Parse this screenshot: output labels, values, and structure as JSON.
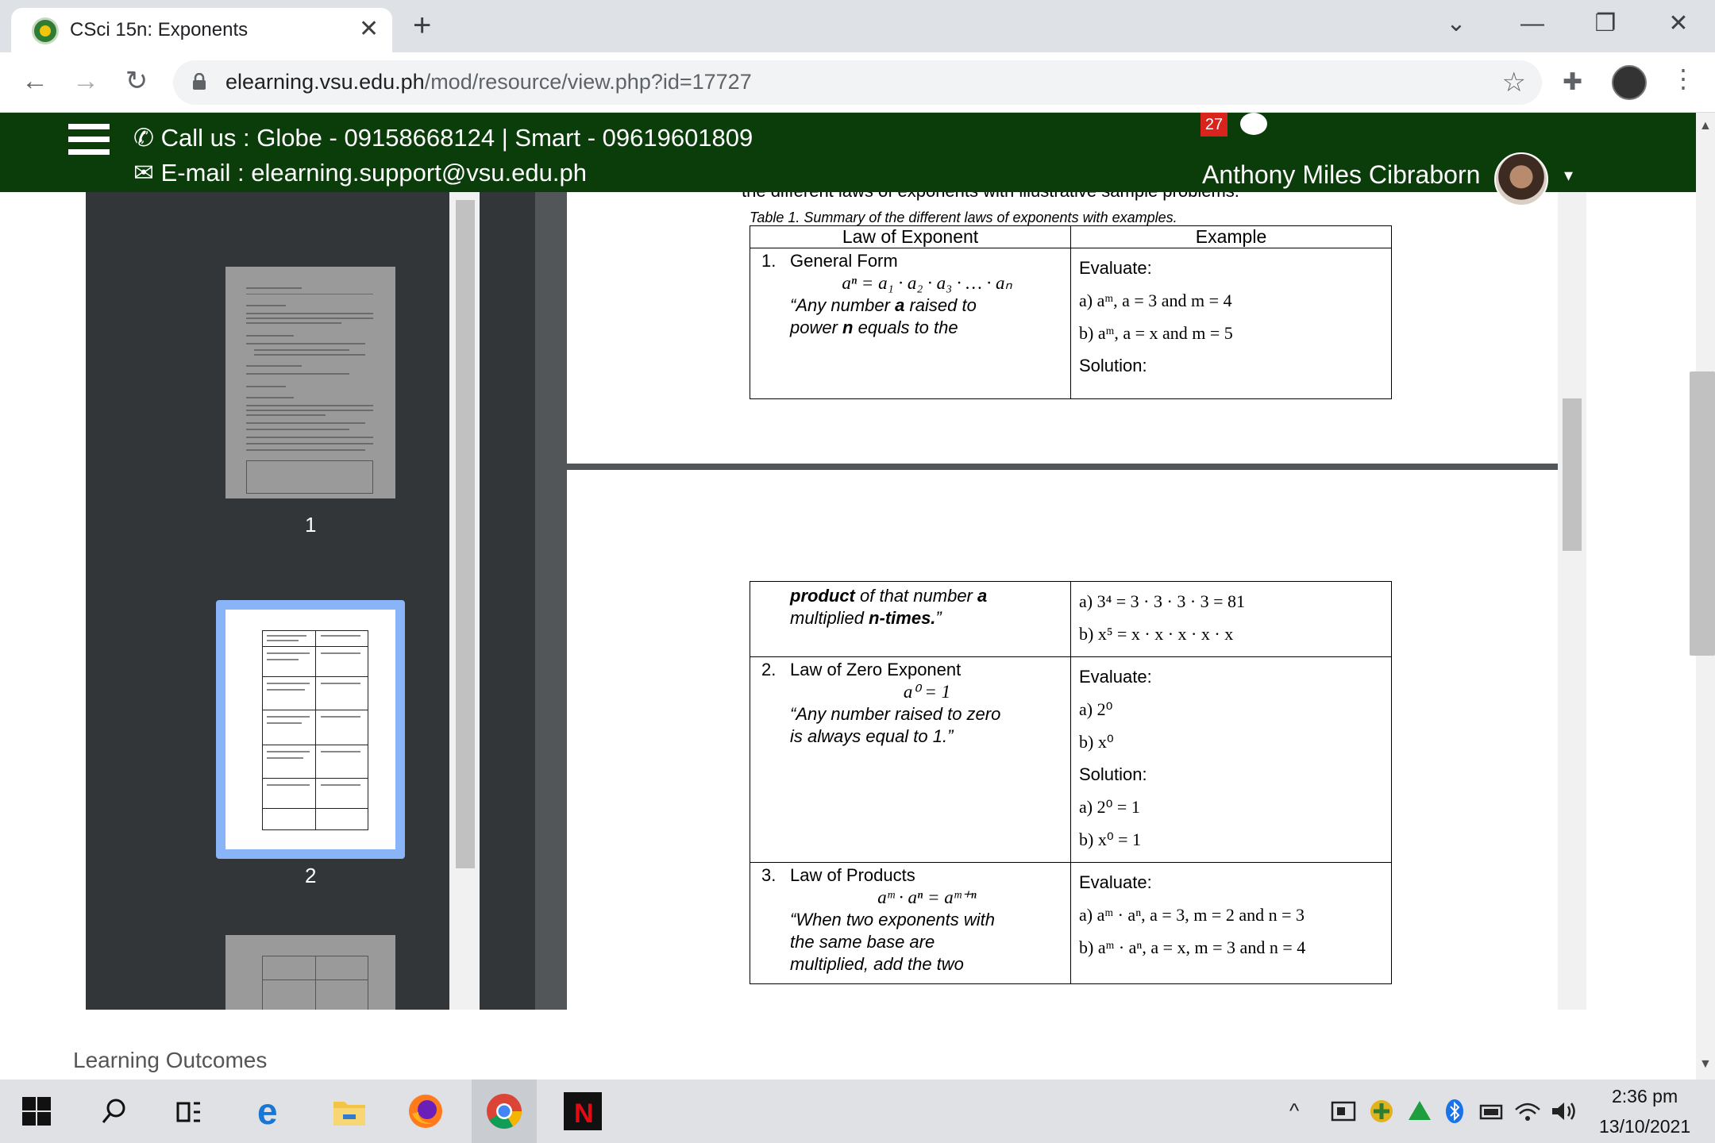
{
  "browser": {
    "tab_title": "CSci 15n: Exponents",
    "close_glyph": "✕",
    "new_tab_glyph": "+",
    "url_host": "elearning.vsu.edu.ph",
    "url_path": "/mod/resource/view.php?id=17727",
    "back_glyph": "←",
    "forward_glyph": "→",
    "reload_glyph": "↻",
    "star_glyph": "☆",
    "extensions_glyph": "✚",
    "menu_glyph": "⋮",
    "window_controls": {
      "dropdown": "⌄",
      "minimize": "—",
      "restore": "❐",
      "close": "✕"
    }
  },
  "site_header": {
    "call_us": "Call us : Globe - 09158668124 | Smart - 09619601809",
    "email": "E-mail : elearning.support@vsu.edu.ph",
    "notification_count": "27",
    "user_name": "Anthony Miles Cibraborn",
    "caret": "▾",
    "phone_glyph": "✆",
    "mail_glyph": "✉"
  },
  "pdf": {
    "thumbnails": [
      {
        "page": "1"
      },
      {
        "page": "2"
      }
    ],
    "page1": {
      "cut_text": "the different laws of exponents with illustrative sample problems.",
      "caption": "Table 1. Summary of the different laws of exponents with examples.",
      "col_law": "Law of Exponent",
      "col_example": "Example",
      "row1": {
        "num": "1.",
        "name": "General Form",
        "formula": "aⁿ = a₁ · a₂ · a₃ ·  …  · aₙ",
        "quote_1": "“Any number",
        "quote_bold_1": "a",
        "quote_2": "raised to",
        "quote_3": "power",
        "quote_bold_2": "n",
        "quote_4": "equals to the",
        "ex_evaluate": "Evaluate:",
        "ex_a": "a) aᵐ, a = 3 and m = 4",
        "ex_b": "b) aᵐ, a = x and m = 5",
        "ex_solution": "Solution:"
      }
    },
    "page2": {
      "row1_cont": {
        "line1_bold": "product",
        "line1": "of that number",
        "line1_var": "a",
        "line2": "multiplied",
        "line2_bold": "n-times.",
        "line2_end": "”",
        "ans_a": "a) 3⁴ = 3 · 3 · 3 · 3 = 81",
        "ans_b": "b) x⁵ = x · x · x · x · x"
      },
      "row2": {
        "num": "2.",
        "name": "Law of Zero Exponent",
        "formula": "a⁰ = 1",
        "quote_1": "“Any number raised to zero",
        "quote_2": "is always equal to 1.”",
        "ex_evaluate": "Evaluate:",
        "ex_a": "a) 2⁰",
        "ex_b": "b) x⁰",
        "ex_solution": "Solution:",
        "ans_a": "a) 2⁰ = 1",
        "ans_b": "b) x⁰ = 1"
      },
      "row3": {
        "num": "3.",
        "name": "Law of Products",
        "formula": "aᵐ · aⁿ = aᵐ⁺ⁿ",
        "quote_1": "“When two exponents with",
        "quote_2": "the same base are",
        "quote_3": "multiplied, add the two",
        "ex_evaluate": "Evaluate:",
        "ex_a": "a) aᵐ · aⁿ, a = 3, m = 2 and n = 3",
        "ex_b": "b) aᵐ · aⁿ, a = x, m = 3 and n = 4"
      }
    }
  },
  "below_viewer": {
    "learning_outcomes": "Learning Outcomes"
  },
  "taskbar": {
    "time": "2:36 pm",
    "date": "13/10/2021",
    "tray_caret": "^"
  },
  "colors": {
    "header_green": "#0b3d0b",
    "badge_red": "#d9231d",
    "thumb_highlight": "#8ab4f8",
    "pdf_background": "#525659"
  }
}
